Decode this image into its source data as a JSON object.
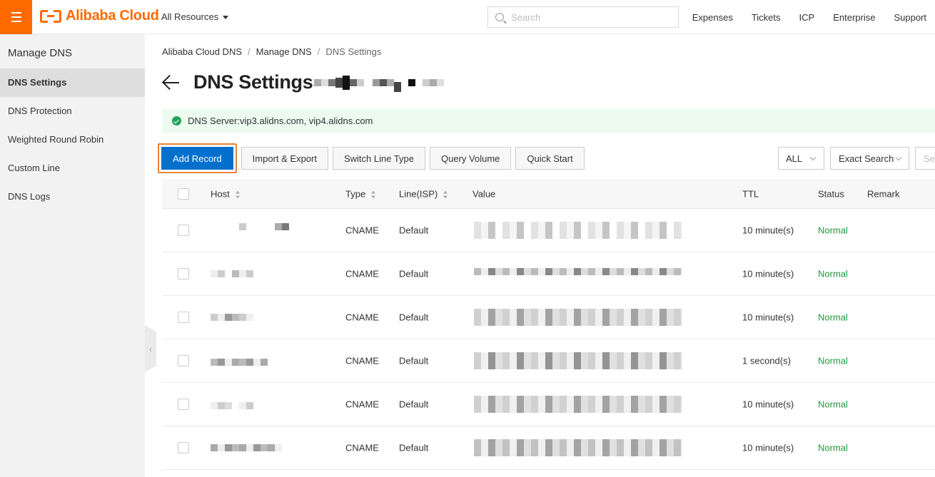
{
  "topbar": {
    "logo_text": "Alibaba Cloud",
    "all_resources": "All Resources",
    "search_placeholder": "Search",
    "links": [
      "Expenses",
      "Tickets",
      "ICP",
      "Enterprise",
      "Support"
    ]
  },
  "sidebar": {
    "title": "Manage DNS",
    "items": [
      {
        "label": "DNS Settings",
        "active": true
      },
      {
        "label": "DNS Protection",
        "active": false
      },
      {
        "label": "Weighted Round Robin",
        "active": false
      },
      {
        "label": "Custom Line",
        "active": false
      },
      {
        "label": "DNS Logs",
        "active": false
      }
    ]
  },
  "breadcrumb": [
    "Alibaba Cloud DNS",
    "Manage DNS",
    "DNS Settings"
  ],
  "page": {
    "title": "DNS Settings",
    "notice": "DNS Server:vip3.alidns.com, vip4.alidns.com"
  },
  "toolbar": {
    "add_record": "Add Record",
    "import_export": "Import & Export",
    "switch_line_type": "Switch Line Type",
    "query_volume": "Query Volume",
    "quick_start": "Quick Start",
    "filter_all": "ALL",
    "filter_exact": "Exact Search",
    "search_partial": "Se"
  },
  "table": {
    "headers": {
      "host": "Host",
      "type": "Type",
      "line": "Line(ISP)",
      "value": "Value",
      "ttl": "TTL",
      "status": "Status",
      "remark": "Remark"
    },
    "rows": [
      {
        "type": "CNAME",
        "line": "Default",
        "ttl": "10 minute(s)",
        "status": "Normal"
      },
      {
        "type": "CNAME",
        "line": "Default",
        "ttl": "10 minute(s)",
        "status": "Normal"
      },
      {
        "type": "CNAME",
        "line": "Default",
        "ttl": "10 minute(s)",
        "status": "Normal"
      },
      {
        "type": "CNAME",
        "line": "Default",
        "ttl": "1 second(s)",
        "status": "Normal"
      },
      {
        "type": "CNAME",
        "line": "Default",
        "ttl": "10 minute(s)",
        "status": "Normal"
      },
      {
        "type": "CNAME",
        "line": "Default",
        "ttl": "10 minute(s)",
        "status": "Normal"
      }
    ]
  },
  "colors": {
    "brand": "#ff6a00",
    "primary": "#0070cc",
    "status_normal": "#1a9c3a",
    "notice_bg": "#ecfaf0"
  }
}
